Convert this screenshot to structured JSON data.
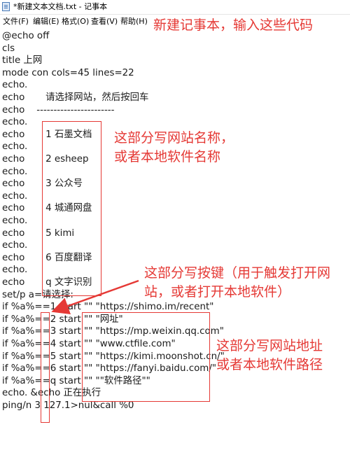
{
  "window": {
    "title": "*新建文本文档.txt - 记事本"
  },
  "menu": {
    "file": "文件(F)",
    "edit": "编辑(E)",
    "format": "格式(O)",
    "view": "查看(V)",
    "help": "帮助(H)"
  },
  "editor": {
    "lines": [
      "@echo off",
      "cls",
      "title 上网",
      "mode con cols=45 lines=22",
      "echo.",
      "echo       请选择网站，然后按回车",
      "echo    -----------------------",
      "echo.",
      "echo       1 石墨文档",
      "echo.",
      "echo       2 esheep",
      "echo.",
      "echo       3 公众号",
      "echo.",
      "echo       4 城通网盘",
      "echo.",
      "echo       5 kimi",
      "echo.",
      "echo       6 百度翻译",
      "echo.",
      "echo       q 文字识别",
      "set/p a=请选择:",
      "if %a%==1 start \"\" \"https://shimo.im/recent\"",
      "if %a%==2 start \"\" \"网址\"",
      "if %a%==3 start \"\" \"https://mp.weixin.qq.com\"",
      "if %a%==4 start \"\" \"www.ctfile.com\"",
      "if %a%==5 start \"\" \"https://kimi.moonshot.cn/\"",
      "if %a%==6 start \"\" \"https://fanyi.baidu.com/\"",
      "if %a%==q start \"\" \"\"软件路径\"\"",
      "echo. &echo 正在执行",
      "ping/n 3 127.1>nul&call %0"
    ]
  },
  "annotations": {
    "top_note": "新建记事本，输入这些代码",
    "names_note_line1": "这部分写网站名称，",
    "names_note_line2": "或者本地软件名称",
    "keys_note_line1": "这部分写按键（用于触发打开网",
    "keys_note_line2": "站，或者打开本地软件）",
    "urls_note_line1": "这部分写网站地址",
    "urls_note_line2": "或者本地软件路径",
    "color": "#e53935"
  }
}
